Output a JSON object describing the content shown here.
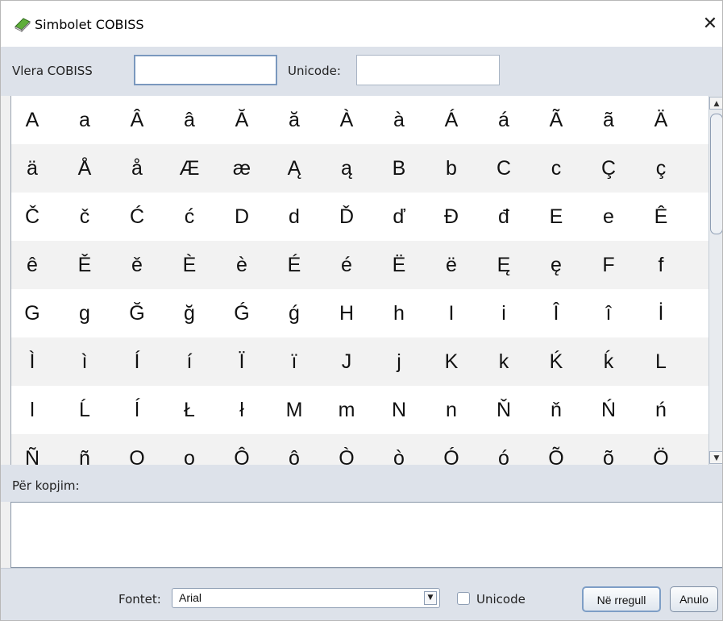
{
  "window": {
    "title": "Simbolet COBISS",
    "close_glyph": "✕"
  },
  "icons": {
    "app": "green-book-icon",
    "close": "close-icon"
  },
  "top_row": {
    "cobiss_label": "Vlera COBISS",
    "cobiss_value": "",
    "unicode_label": "Unicode:",
    "unicode_value": ""
  },
  "symbols": [
    [
      "A",
      "a",
      "Â",
      "â",
      "Ă",
      "ă",
      "À",
      "à",
      "Á",
      "á",
      "Ã",
      "ã",
      "Ä"
    ],
    [
      "ä",
      "Å",
      "å",
      "Æ",
      "æ",
      "Ą",
      "ą",
      "B",
      "b",
      "C",
      "c",
      "Ç",
      "ç"
    ],
    [
      "Č",
      "č",
      "Ć",
      "ć",
      "D",
      "d",
      "Ď",
      "ď",
      "Đ",
      "đ",
      "E",
      "e",
      "Ê"
    ],
    [
      "ê",
      "Ě",
      "ě",
      "È",
      "è",
      "É",
      "é",
      "Ë",
      "ë",
      "Ę",
      "ę",
      "F",
      "f"
    ],
    [
      "G",
      "g",
      "Ğ",
      "ğ",
      "Ǵ",
      "ǵ",
      "H",
      "h",
      "I",
      "i",
      "Î",
      "î",
      "İ"
    ],
    [
      "Ì",
      "ì",
      "Í",
      "í",
      "Ï",
      "ï",
      "J",
      "j",
      "K",
      "k",
      "Ḱ",
      "ḱ",
      "L"
    ],
    [
      "l",
      "Ĺ",
      "ĺ",
      "Ł",
      "ł",
      "M",
      "m",
      "N",
      "n",
      "Ň",
      "ň",
      "Ń",
      "ń"
    ],
    [
      "Ñ",
      "ñ",
      "O",
      "o",
      "Ô",
      "ô",
      "Ò",
      "ò",
      "Ó",
      "ó",
      "Õ",
      "õ",
      "Ö"
    ]
  ],
  "copy": {
    "label": "Për kopjim:",
    "value": ""
  },
  "bottom": {
    "font_label": "Fontet:",
    "font_selected": "Arial",
    "unicode_checkbox_label": "Unicode",
    "unicode_checked": false,
    "ok_label": "Në rregull",
    "cancel_label": "Anulo"
  },
  "scroll": {
    "up_glyph": "▲",
    "down_glyph": "▼",
    "dropdown_glyph": "▼"
  }
}
